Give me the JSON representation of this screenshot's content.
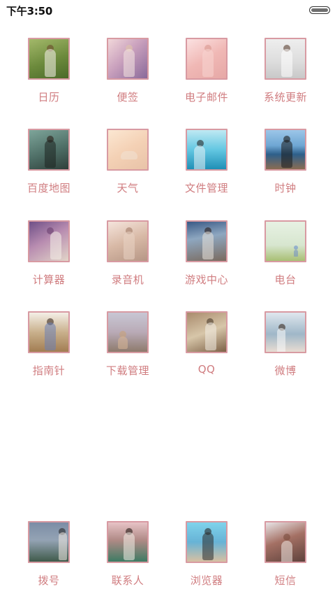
{
  "status_bar": {
    "time": "下午3:50",
    "battery_icon": "battery-icon"
  },
  "apps": [
    {
      "label": "日历",
      "icon": "calendar-icon"
    },
    {
      "label": "便签",
      "icon": "notes-icon"
    },
    {
      "label": "电子邮件",
      "icon": "email-icon"
    },
    {
      "label": "系统更新",
      "icon": "system-update-icon"
    },
    {
      "label": "百度地图",
      "icon": "baidu-map-icon"
    },
    {
      "label": "天气",
      "icon": "weather-icon"
    },
    {
      "label": "文件管理",
      "icon": "file-manager-icon"
    },
    {
      "label": "时钟",
      "icon": "clock-icon"
    },
    {
      "label": "计算器",
      "icon": "calculator-icon"
    },
    {
      "label": "录音机",
      "icon": "recorder-icon"
    },
    {
      "label": "游戏中心",
      "icon": "game-center-icon"
    },
    {
      "label": "电台",
      "icon": "radio-icon"
    },
    {
      "label": "指南针",
      "icon": "compass-icon"
    },
    {
      "label": "下载管理",
      "icon": "download-manager-icon"
    },
    {
      "label": "QQ",
      "icon": "qq-icon"
    },
    {
      "label": "微博",
      "icon": "weibo-icon"
    }
  ],
  "dock": [
    {
      "label": "拨号",
      "icon": "dialer-icon"
    },
    {
      "label": "联系人",
      "icon": "contacts-icon"
    },
    {
      "label": "浏览器",
      "icon": "browser-icon"
    },
    {
      "label": "短信",
      "icon": "sms-icon"
    }
  ],
  "colors": {
    "label": "#d07d80",
    "icon_border": "#d89aa2",
    "background": "#ffffff"
  }
}
